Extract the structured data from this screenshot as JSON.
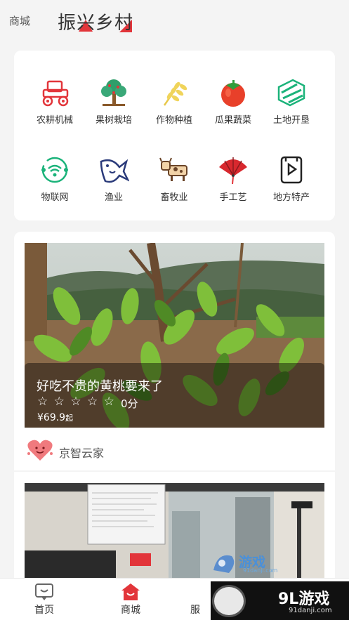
{
  "header": {
    "left_label": "商城",
    "title": "振兴乡村"
  },
  "categories": [
    {
      "label": "农耕机械",
      "icon": "tractor-icon"
    },
    {
      "label": "果树栽培",
      "icon": "fruit-tree-icon"
    },
    {
      "label": "作物种植",
      "icon": "wheat-icon"
    },
    {
      "label": "瓜果蔬菜",
      "icon": "tomato-icon"
    },
    {
      "label": "土地开垦",
      "icon": "land-icon"
    },
    {
      "label": "物联网",
      "icon": "iot-icon"
    },
    {
      "label": "渔业",
      "icon": "fish-icon"
    },
    {
      "label": "畜牧业",
      "icon": "cow-icon"
    },
    {
      "label": "手工艺",
      "icon": "fan-icon"
    },
    {
      "label": "地方特产",
      "icon": "specialty-icon"
    }
  ],
  "product": {
    "title": "好吃不贵的黄桃要来了",
    "stars": [
      "☆",
      "☆",
      "☆",
      "☆",
      "☆"
    ],
    "score": "0分",
    "price": "¥69.9",
    "price_suffix": "起",
    "shop_name": "京智云家"
  },
  "tabbar": {
    "home": "首页",
    "mall": "商城",
    "third": "服"
  },
  "watermarks": {
    "overlay_text": "游戏",
    "overlay_url": "91danji.com",
    "corner_text": "9L游戏",
    "corner_url": "91danji.com"
  },
  "colors": {
    "accent": "#e2353a",
    "teal": "#1bb37a",
    "navy": "#2a3a7a"
  }
}
